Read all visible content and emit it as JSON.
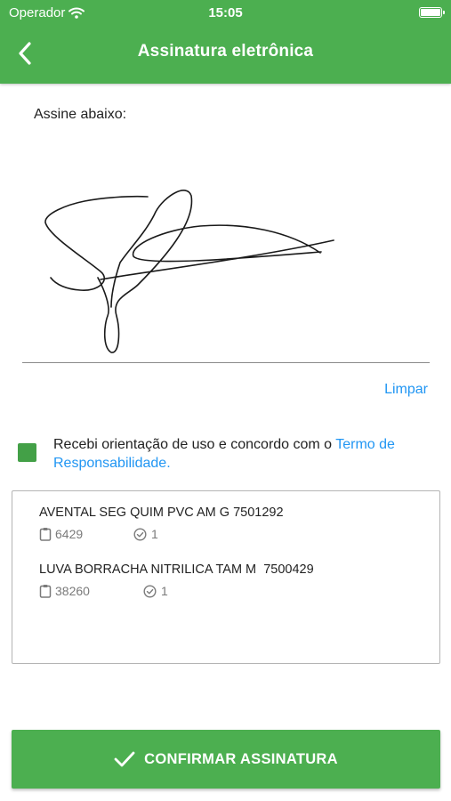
{
  "status_bar": {
    "carrier": "Operador",
    "time": "15:05"
  },
  "header": {
    "title": "Assinatura eletrônica",
    "back_icon": "chevron-left-icon"
  },
  "signature": {
    "label": "Assine abaixo:",
    "clear_label": "Limpar"
  },
  "agreement": {
    "checked": true,
    "text": "Recebi orientação de uso e concordo com o ",
    "link_text": "Termo de Responsabilidade."
  },
  "items": [
    {
      "name": "AVENTAL SEG QUIM PVC AM G 7501292",
      "code": "6429",
      "quantity": "1"
    },
    {
      "name": "LUVA BORRACHA NITRILICA TAM M  7500429",
      "code": "38260",
      "quantity": "1"
    }
  ],
  "confirm": {
    "label": "CONFIRMAR ASSINATURA",
    "icon": "check-icon"
  },
  "colors": {
    "primary": "#4caf50",
    "link": "#2196f3",
    "checkbox": "#43a047"
  }
}
